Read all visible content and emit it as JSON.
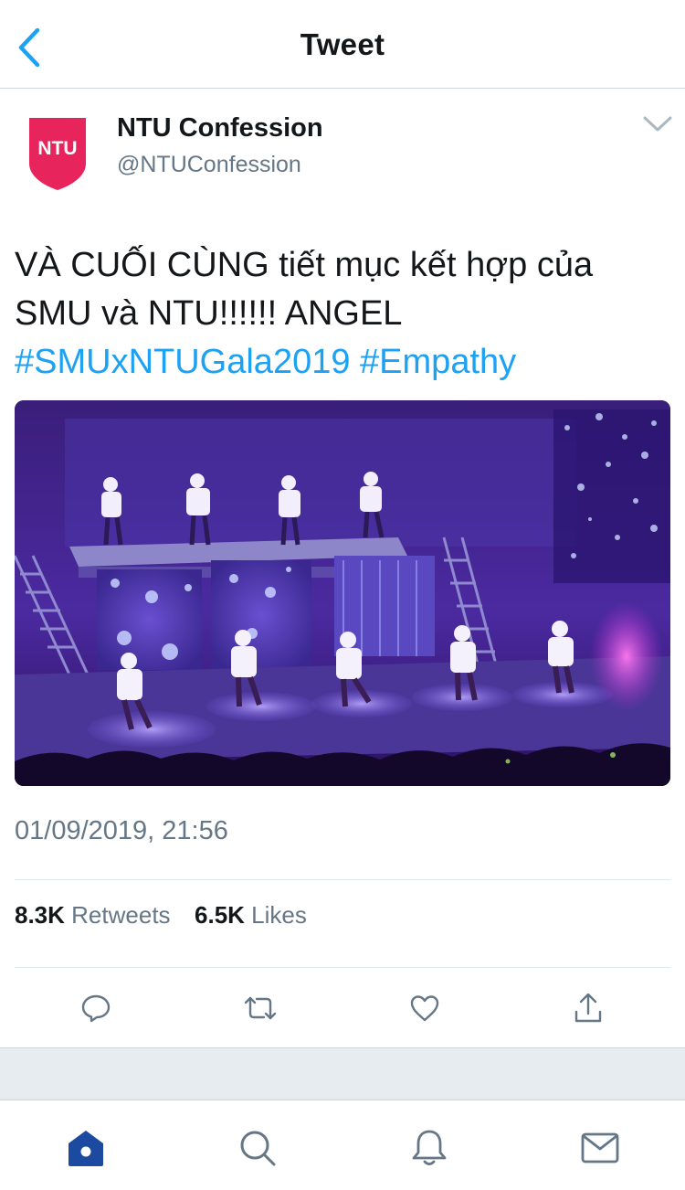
{
  "header": {
    "title": "Tweet",
    "back_icon": "chevron-left-icon"
  },
  "author": {
    "avatar_text": "NTU",
    "avatar_color": "#e8245c",
    "name": "NTU Confession",
    "handle": "@NTUConfession"
  },
  "tweet": {
    "text_line1": "VÀ CUỐI CÙNG tiết mục kết hợp của",
    "text_line2": "SMU và NTU!!!!!! ANGEL",
    "hashtags": [
      "#SMUxNTUGala2019",
      "#Empathy"
    ],
    "timestamp": "01/09/2019, 21:56"
  },
  "stats": {
    "retweets_count": "8.3K",
    "retweets_label": "Retweets",
    "likes_count": "6.5K",
    "likes_label": "Likes"
  },
  "actions": [
    "reply-icon",
    "retweet-icon",
    "like-icon",
    "share-icon"
  ],
  "tabbar": [
    "home-icon",
    "search-icon",
    "notifications-icon",
    "messages-icon"
  ],
  "colors": {
    "accent": "#1da1f2",
    "text_primary": "#14171a",
    "text_secondary": "#657786",
    "tab_active": "#1b4aa0",
    "icon_gray": "#657786"
  }
}
